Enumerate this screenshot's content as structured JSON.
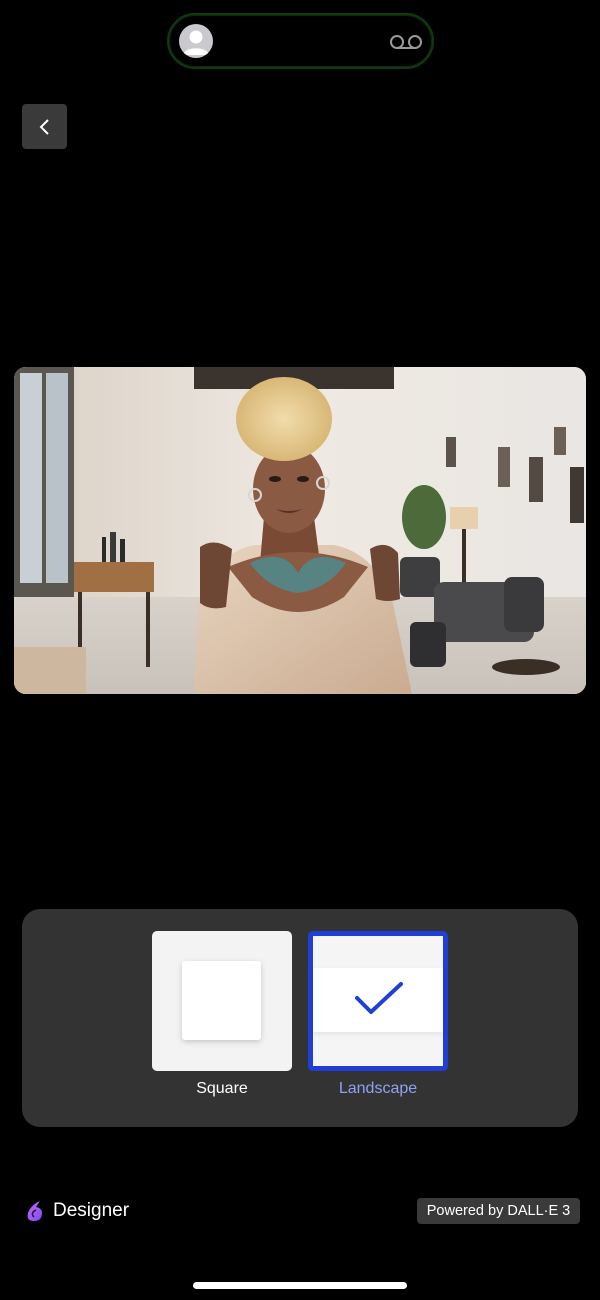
{
  "status_pill": {
    "avatar_icon": "person-avatar-icon",
    "right_icon": "voicemail-icon",
    "outline_color": "#0f3a12"
  },
  "nav": {
    "back_icon": "chevron-left-icon"
  },
  "image": {
    "subject": "portrait"
  },
  "aspect_options": {
    "selected": "Landscape",
    "accent_color": "#1f3fd6",
    "items": [
      {
        "label": "Square",
        "icon": "square-icon",
        "selected": false
      },
      {
        "label": "Landscape",
        "icon": "checkmark-icon",
        "selected": true
      }
    ]
  },
  "footer": {
    "brand_name": "Designer",
    "brand_icon": "designer-logo-icon",
    "powered_by": "Powered by DALL·E 3"
  }
}
